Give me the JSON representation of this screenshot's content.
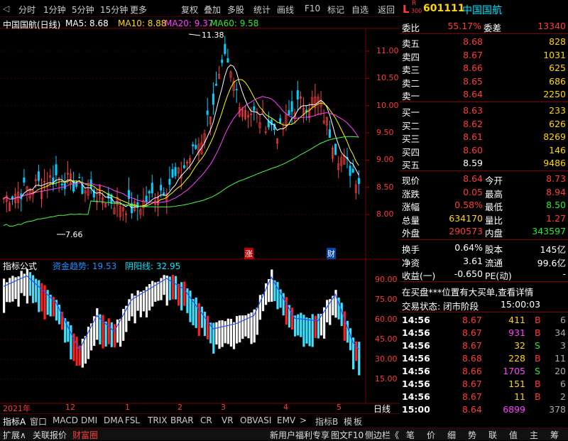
{
  "toolbar": {
    "items": [
      "分时",
      "1分钟",
      "5分钟",
      "15分钟",
      "更多",
      "复权",
      "叠加",
      "多股",
      "统计",
      "画线",
      "F10",
      "标记",
      "自选",
      "返回"
    ]
  },
  "stock": {
    "code": "601111",
    "name": "中国国航",
    "l_badge": "L",
    "r_badge": "R",
    "badge_num": "300"
  },
  "chart": {
    "title": "中国国航(日线)",
    "ma5": "MA5: 8.68",
    "ma10": "MA10: 8.88",
    "ma20": "MA20: 9.37",
    "ma60": "MA60: 9.58",
    "high_label": "11.38",
    "low_label": "7.66",
    "yticks": [
      "11.00",
      "10.50",
      "10.00",
      "9.50",
      "9.00",
      "8.50",
      "8.00"
    ],
    "badge_zhang": "涨",
    "badge_cai": "财"
  },
  "indicator": {
    "title": "指标公式",
    "line1": "资金趋势: 19.53",
    "line2": "阴阳线: 32.95",
    "yticks": [
      "90.00",
      "75.00",
      "60.00",
      "45.00",
      "30.00",
      "15.00"
    ]
  },
  "xaxis": {
    "labels": [
      "2021年",
      "12",
      "1",
      "2",
      "3",
      "4",
      "5"
    ],
    "period": "日线"
  },
  "order_book": {
    "weibi_label": "委比",
    "weibi": "55.17%",
    "weicha_label": "委差",
    "weicha": "13340",
    "sells": [
      {
        "label": "卖五",
        "price": "8.68",
        "vol": "828"
      },
      {
        "label": "卖四",
        "price": "8.67",
        "vol": "1031"
      },
      {
        "label": "卖三",
        "price": "8.66",
        "vol": "625"
      },
      {
        "label": "卖二",
        "price": "8.65",
        "vol": "686"
      },
      {
        "label": "卖一",
        "price": "8.64",
        "vol": "2250"
      }
    ],
    "buys": [
      {
        "label": "买一",
        "price": "8.63",
        "vol": "233"
      },
      {
        "label": "买二",
        "price": "8.62",
        "vol": "626"
      },
      {
        "label": "买三",
        "price": "8.61",
        "vol": "8269"
      },
      {
        "label": "买四",
        "price": "8.60",
        "vol": "146"
      },
      {
        "label": "买五",
        "price": "8.59",
        "vol": "9486"
      }
    ]
  },
  "quote": [
    {
      "l1": "现价",
      "v1": "8.64",
      "l2": "今开",
      "v2": "8.73"
    },
    {
      "l1": "涨跌",
      "v1": "0.05",
      "l2": "最高",
      "v2": "8.94"
    },
    {
      "l1": "涨幅",
      "v1": "0.58%",
      "l2": "最低",
      "v2": "8.50"
    },
    {
      "l1": "总量",
      "v1": "634170",
      "l2": "量比",
      "v2": "1.27"
    },
    {
      "l1": "外盘",
      "v1": "290573",
      "l2": "内盘",
      "v2": "343597"
    }
  ],
  "stats": [
    {
      "l1": "换手",
      "v1": "0.64%",
      "l2": "股本",
      "v2": "145亿"
    },
    {
      "l1": "净资",
      "v1": "3.61",
      "l2": "流通",
      "v2": "99.6亿"
    },
    {
      "l1": "收益(一)",
      "v1": "-0.650",
      "l2": "PE(动)",
      "v2": "-"
    }
  ],
  "notice": "在买盘***位置有大买单,查看详情",
  "trade_status": {
    "label": "交易状态: 闭市阶段",
    "time": "15:00:03"
  },
  "ticks": [
    {
      "t": "14:56",
      "p": "8.67",
      "v": "411",
      "s": "B",
      "n": "6"
    },
    {
      "t": "14:56",
      "p": "8.67",
      "v": "931",
      "s": "B",
      "n": "34"
    },
    {
      "t": "14:56",
      "p": "8.67",
      "v": "32",
      "s": "S",
      "n": "3"
    },
    {
      "t": "14:56",
      "p": "8.68",
      "v": "228",
      "s": "B",
      "n": "11"
    },
    {
      "t": "14:56",
      "p": "8.66",
      "v": "1705",
      "s": "S",
      "n": "20"
    },
    {
      "t": "14:56",
      "p": "8.67",
      "v": "151",
      "s": "B",
      "n": "6"
    },
    {
      "t": "14:56",
      "p": "8.67",
      "v": "11",
      "s": "B",
      "n": "2"
    },
    {
      "t": "15:00",
      "p": "8.64",
      "v": "6899",
      "s": "",
      "n": "378"
    }
  ],
  "indicator_tabs": [
    "指标A",
    "窗口",
    "MACD",
    "DMI",
    "DMA",
    "FSL",
    "TRIX",
    "BRAR",
    "CR",
    "VR",
    "OBV",
    "ASI",
    "EMV",
    ">",
    "指标B",
    "模",
    "板"
  ],
  "footer_left": [
    "扩展∧",
    "关联报价",
    "财富圈"
  ],
  "footer_mid": [
    "新用户福利专享",
    "图文F10",
    "侧边栏《"
  ],
  "footer_right": [
    "笔",
    "价",
    "细",
    "势",
    "联",
    "值",
    "主",
    "筹"
  ]
}
